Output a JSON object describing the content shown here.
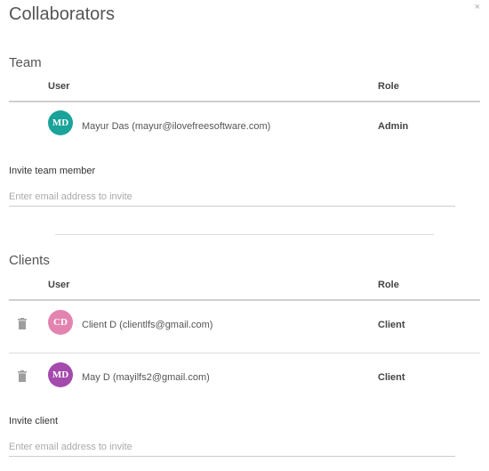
{
  "dialog": {
    "title": "Collaborators",
    "close_label": "×"
  },
  "team": {
    "title": "Team",
    "col_user": "User",
    "col_role": "Role",
    "members": [
      {
        "initials": "MD",
        "name": "Mayur Das (mayur@ilovefreesoftware.com)",
        "role": "Admin",
        "color": "#1aa39a"
      }
    ],
    "invite_label": "Invite team member",
    "invite_placeholder": "Enter email address to invite"
  },
  "clients": {
    "title": "Clients",
    "col_user": "User",
    "col_role": "Role",
    "members": [
      {
        "initials": "CD",
        "name": "Client D (clientlfs@gmail.com)",
        "role": "Client",
        "color": "#e384b0"
      },
      {
        "initials": "MD",
        "name": "May D (mayilfs2@gmail.com)",
        "role": "Client",
        "color": "#a54aad"
      }
    ],
    "invite_label": "Invite client",
    "invite_placeholder": "Enter email address to invite"
  }
}
